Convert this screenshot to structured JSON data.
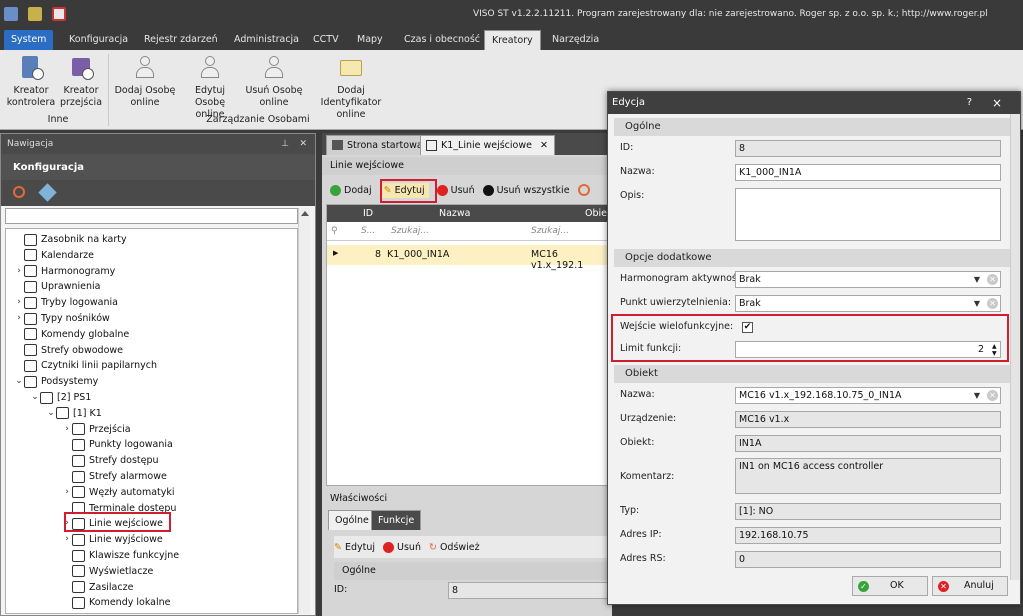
{
  "app": {
    "title": "VISO ST v1.2.2.11211. Program zarejestrowany dla: nie zarejestrowano. Roger sp. z o.o. sp. k.; http://www.roger.pl"
  },
  "menu": [
    "System",
    "Konfiguracja",
    "Rejestr zdarzeń",
    "Administracja",
    "CCTV",
    "Mapy",
    "Czas i obecność",
    "Kreatory",
    "Narzędzia"
  ],
  "ribbon": {
    "buttons": [
      {
        "line1": "Kreator",
        "line2": "kontrolera"
      },
      {
        "line1": "Kreator",
        "line2": "przejścia"
      },
      {
        "line1": "Dodaj Osobę",
        "line2": "online"
      },
      {
        "line1": "Edytuj Osobę",
        "line2": "online"
      },
      {
        "line1": "Usuń Osobę",
        "line2": "online"
      },
      {
        "line1": "Dodaj Identyfikator",
        "line2": "online"
      }
    ],
    "groups": [
      "Inne",
      "Zarządzanie Osobami"
    ]
  },
  "nav": {
    "header": "Nawigacja",
    "title": "Konfiguracja",
    "tree": [
      {
        "label": "Zasobnik na karty",
        "lvl": 0,
        "arrow": ""
      },
      {
        "label": "Kalendarze",
        "lvl": 0,
        "arrow": ""
      },
      {
        "label": "Harmonogramy",
        "lvl": 0,
        "arrow": ">"
      },
      {
        "label": "Uprawnienia",
        "lvl": 0,
        "arrow": ""
      },
      {
        "label": "Tryby logowania",
        "lvl": 0,
        "arrow": ">"
      },
      {
        "label": "Typy nośników",
        "lvl": 0,
        "arrow": ">"
      },
      {
        "label": "Komendy globalne",
        "lvl": 0,
        "arrow": ""
      },
      {
        "label": "Strefy obwodowe",
        "lvl": 0,
        "arrow": ""
      },
      {
        "label": "Czytniki linii papilarnych",
        "lvl": 0,
        "arrow": ""
      },
      {
        "label": "Podsystemy",
        "lvl": 0,
        "arrow": "v"
      },
      {
        "label": "[2] PS1",
        "lvl": 1,
        "arrow": "v"
      },
      {
        "label": "[1] K1",
        "lvl": 2,
        "arrow": "v"
      },
      {
        "label": "Przejścia",
        "lvl": 3,
        "arrow": ">"
      },
      {
        "label": "Punkty logowania",
        "lvl": 3,
        "arrow": ""
      },
      {
        "label": "Strefy dostępu",
        "lvl": 3,
        "arrow": ""
      },
      {
        "label": "Strefy alarmowe",
        "lvl": 3,
        "arrow": ""
      },
      {
        "label": "Węzły automatyki",
        "lvl": 3,
        "arrow": ">"
      },
      {
        "label": "Terminale dostępu",
        "lvl": 3,
        "arrow": ""
      },
      {
        "label": "Linie wejściowe",
        "lvl": 3,
        "arrow": ">"
      },
      {
        "label": "Linie wyjściowe",
        "lvl": 3,
        "arrow": ">"
      },
      {
        "label": "Klawisze funkcyjne",
        "lvl": 3,
        "arrow": ""
      },
      {
        "label": "Wyświetlacze",
        "lvl": 3,
        "arrow": ""
      },
      {
        "label": "Zasilacze",
        "lvl": 3,
        "arrow": ""
      },
      {
        "label": "Komendy lokalne",
        "lvl": 3,
        "arrow": ""
      }
    ]
  },
  "main": {
    "tabs": [
      "Strona startowa",
      "K1_Linie wejściowe"
    ],
    "section_title": "Linie wejściowe",
    "toolbar": [
      "Dodaj",
      "Edytuj",
      "Usuń",
      "Usuń wszystkie"
    ],
    "columns": [
      "ID",
      "Nazwa",
      "Obie"
    ],
    "filter": [
      "S...",
      "Szukaj...",
      "Szukaj..."
    ],
    "row": {
      "id": "8",
      "name": "K1_000_IN1A",
      "obj": "MC16 v1.x_192.1"
    },
    "props_title": "Właściwości",
    "props_tabs": [
      "Ogólne",
      "Funkcje"
    ],
    "props_toolbar": [
      "Edytuj",
      "Usuń",
      "Odśwież"
    ],
    "props_section": "Ogólne",
    "props_id_label": "ID:",
    "props_id_value": "8"
  },
  "dialog": {
    "title": "Edycja",
    "help": "?",
    "close": "×",
    "sections": [
      "Ogólne",
      "Opcje dodatkowe",
      "Obiekt"
    ],
    "fields": {
      "id": {
        "label": "ID:",
        "value": "8"
      },
      "name": {
        "label": "Nazwa:",
        "value": "K1_000_IN1A"
      },
      "desc": {
        "label": "Opis:",
        "value": ""
      },
      "schedule": {
        "label": "Harmonogram aktywności:",
        "value": "Brak"
      },
      "auth": {
        "label": "Punkt uwierzytelnienia:",
        "value": "Brak"
      },
      "multi": {
        "label": "Wejście wielofunkcyjne:",
        "checked": true
      },
      "limit": {
        "label": "Limit funkcji:",
        "value": "2"
      },
      "obj_name": {
        "label": "Nazwa:",
        "value": "MC16 v1.x_192.168.10.75_0_IN1A"
      },
      "device": {
        "label": "Urządzenie:",
        "value": "MC16 v1.x"
      },
      "object": {
        "label": "Obiekt:",
        "value": "IN1A"
      },
      "comment": {
        "label": "Komentarz:",
        "value": "IN1 on MC16 access controller"
      },
      "type": {
        "label": "Typ:",
        "value": "[1]: NO"
      },
      "ip": {
        "label": "Adres IP:",
        "value": "192.168.10.75"
      },
      "rs": {
        "label": "Adres RS:",
        "value": "0"
      }
    },
    "ok": "OK",
    "cancel": "Anuluj"
  },
  "colors": {
    "accent": "#2b6cc4",
    "highlight": "#d11e2e",
    "selected_row": "#fdf1c4"
  }
}
